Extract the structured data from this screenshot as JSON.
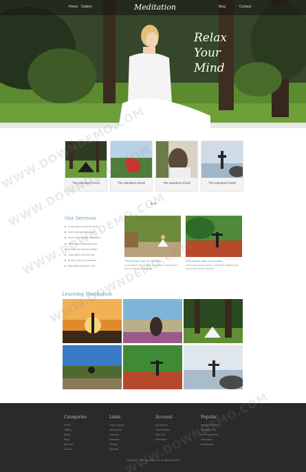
{
  "nav": {
    "items": [
      "Home",
      "Gallery",
      "Blog",
      "Contact"
    ],
    "logo": "Meditation"
  },
  "hero": {
    "tagline_lines": [
      "Relax",
      "Your",
      "Mind"
    ]
  },
  "carousel": {
    "captions": [
      "The standard chunk",
      "The standard chunk",
      "The standard chunk",
      "The standard chunk"
    ]
  },
  "services": {
    "title": "Our Services",
    "items": [
      "Lorem ipsum dolor sit amet",
      "Sed ut perspiciatis unde",
      "Nemo enim ipsam voluptatem",
      "Neque porro quisquam est",
      "Ut enim ad minima veniam",
      "Quis autem vel eum iure",
      "At vero eos et accusamus",
      "Nam libero tempore cum"
    ]
  },
  "features": [
    {
      "title": "Pellentesque vitae nisi at sapien",
      "body": "Lorem ipsum dolor sit amet, consectetur adipiscing elit. Nunc ut nibh at nisi vulputate."
    },
    {
      "title": "Pellentesque vitae nisi at sapien",
      "body": "Lorem ipsum dolor sit amet, consectetur adipiscing elit. Nunc ut nibh at nisi vulputate."
    }
  ],
  "learning": {
    "title": "Learning Meditation"
  },
  "footer": {
    "columns": [
      {
        "title": "Categories",
        "items": [
          "Home",
          "Gallery",
          "Studio",
          "Blog",
          "Services",
          "Contact"
        ]
      },
      {
        "title": "Links",
        "items": [
          "Yoga Classes",
          "Workshops",
          "Teachers",
          "Schedule",
          "Pricing",
          "Retreats"
        ]
      },
      {
        "title": "Account",
        "items": [
          "My Account",
          "Order History",
          "Wish List",
          "Newsletter"
        ]
      },
      {
        "title": "Popular",
        "items": [
          "Meditation Basics",
          "Breathing Tips",
          "Morning Routine",
          "Relaxation",
          "Mindfulness"
        ]
      }
    ],
    "copyright": "Copyright © 2013 Company name All rights reserved."
  },
  "colors": {
    "accent": "#5aa0c8",
    "footer_bg": "#2a2a2a",
    "hero_green": "#4f6a30"
  },
  "watermark": "WWW.DOWNDEMO.COM"
}
